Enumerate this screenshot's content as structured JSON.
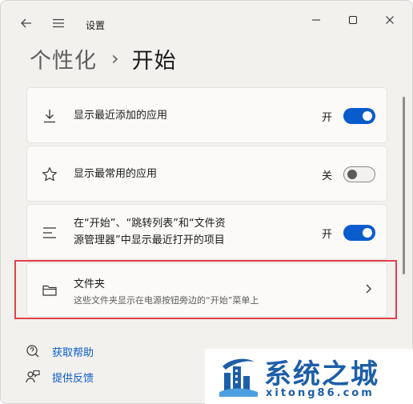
{
  "window": {
    "title": "设置",
    "controls": {
      "minimize": "minimize-icon",
      "maximize": "maximize-icon",
      "close": "close-icon"
    }
  },
  "breadcrumb": {
    "parent": "个性化",
    "separator": "›",
    "current": "开始"
  },
  "settings": [
    {
      "icon": "download-icon",
      "label": "显示最近添加的应用",
      "state_text": "开",
      "toggle": "on"
    },
    {
      "icon": "star-icon",
      "label": "显示最常用的应用",
      "state_text": "关",
      "toggle": "off"
    },
    {
      "icon": "list-icon",
      "label_line1": "在“开始”、“跳转列表”和“文件资",
      "label_line2": "源管理器”中显示最近打开的项目",
      "state_text": "开",
      "toggle": "on"
    },
    {
      "icon": "folder-icon",
      "label": "文件夹",
      "description": "这些文件夹显示在电源按钮旁边的“开始”菜单上",
      "action": "chevron-right-icon"
    }
  ],
  "footer": {
    "help": {
      "icon": "help-icon",
      "label": "获取帮助"
    },
    "feedback": {
      "icon": "feedback-icon",
      "label": "提供反馈"
    }
  },
  "watermark": {
    "title": "系统之城",
    "url": "xitong86.com"
  },
  "colors": {
    "accent": "#0a5ccc",
    "highlight": "#e0424a",
    "background": "#f3f1ee",
    "card": "#fbfaf8"
  }
}
